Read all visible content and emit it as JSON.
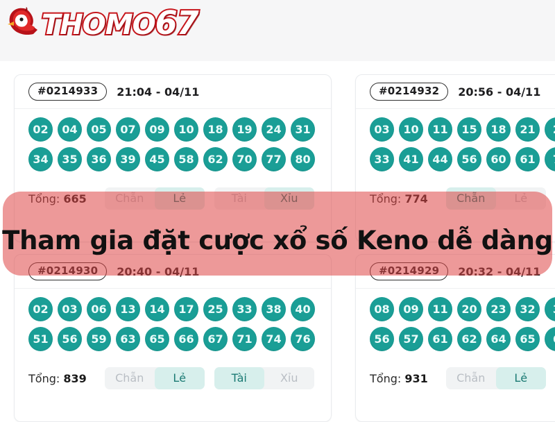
{
  "header": {
    "logo_text_main": "THOMO",
    "logo_text_number": "67",
    "logo_icon": "rooster-head-icon"
  },
  "promo": {
    "text": "Tham gia đặt cược xổ số Keno dễ dàng",
    "color": "#df4646"
  },
  "theme": {
    "ball_color": "#1a9e96",
    "active_bet_bg": "#d7efec",
    "active_bet_text": "#1a7a73",
    "inactive_bet_text": "#b9bec4"
  },
  "bet_labels": {
    "chan": "Chẵn",
    "le": "Lẻ",
    "tai": "Tài",
    "xiu": "Xỉu"
  },
  "total_label": "Tổng:",
  "cards": [
    {
      "draw_id": "#0214933",
      "time": "21:04 - 04/11",
      "row1": [
        "02",
        "04",
        "05",
        "07",
        "09",
        "10",
        "18",
        "19",
        "24",
        "31"
      ],
      "row2": [
        "34",
        "35",
        "36",
        "39",
        "45",
        "58",
        "62",
        "70",
        "77",
        "80"
      ],
      "total": "665",
      "active": [
        "le",
        "xiu"
      ]
    },
    {
      "draw_id": "#0214932",
      "time": "20:56 - 04/11",
      "row1": [
        "03",
        "10",
        "11",
        "15",
        "18",
        "21",
        "2"
      ],
      "row2": [
        "33",
        "41",
        "44",
        "56",
        "60",
        "61",
        "7"
      ],
      "total": "774",
      "active": [
        "chan"
      ]
    },
    {
      "draw_id": "#0214930",
      "time": "20:40 - 04/11",
      "row1": [
        "02",
        "03",
        "06",
        "13",
        "14",
        "17",
        "25",
        "33",
        "38",
        "40"
      ],
      "row2": [
        "51",
        "56",
        "59",
        "63",
        "65",
        "66",
        "67",
        "71",
        "74",
        "76"
      ],
      "total": "839",
      "active": [
        "le",
        "tai"
      ]
    },
    {
      "draw_id": "#0214929",
      "time": "20:32 - 04/11",
      "row1": [
        "08",
        "09",
        "11",
        "20",
        "23",
        "32",
        "3"
      ],
      "row2": [
        "56",
        "57",
        "61",
        "62",
        "64",
        "65",
        "6"
      ],
      "total": "931",
      "active": [
        "le"
      ]
    }
  ]
}
